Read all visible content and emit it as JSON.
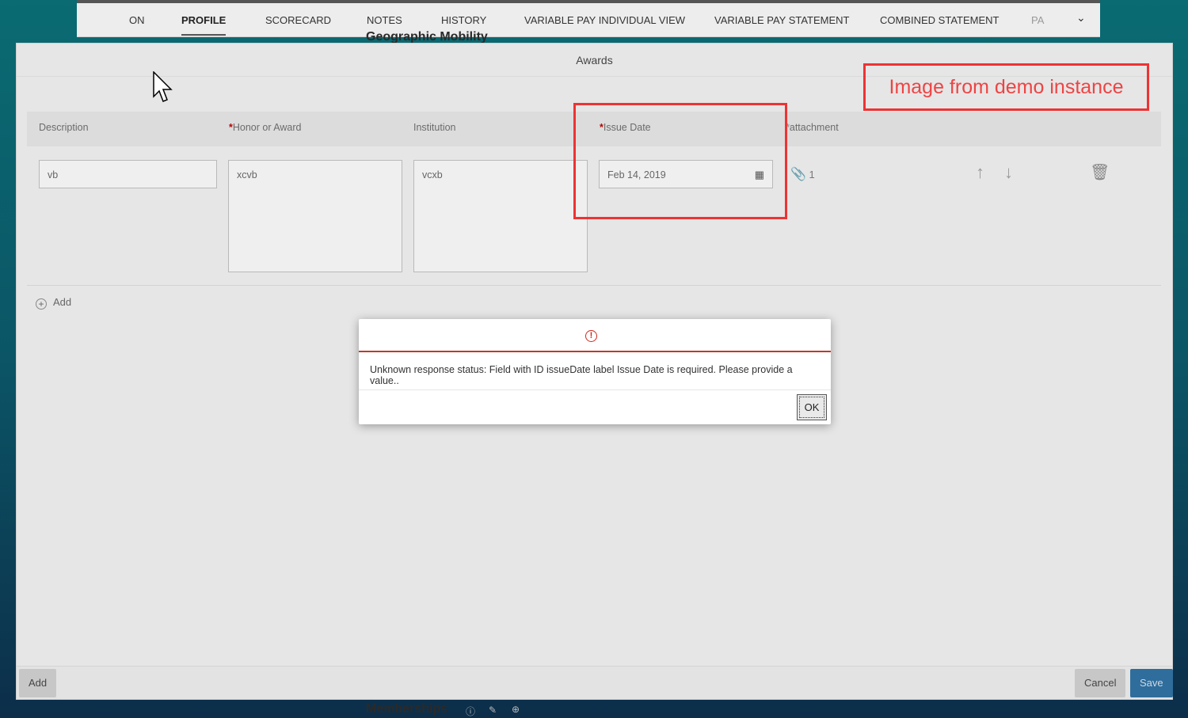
{
  "tabs": [
    {
      "label": "ON"
    },
    {
      "label": "PROFILE"
    },
    {
      "label": "SCORECARD"
    },
    {
      "label": "NOTES"
    },
    {
      "label": "HISTORY"
    },
    {
      "label": "VARIABLE PAY INDIVIDUAL VIEW"
    },
    {
      "label": "VARIABLE PAY STATEMENT"
    },
    {
      "label": "COMBINED STATEMENT"
    },
    {
      "label": "PA"
    }
  ],
  "behind": {
    "geo_heading": "Geographic Mobility",
    "memberships_heading": "Memberships"
  },
  "awards": {
    "title": "Awards",
    "columns": {
      "description": "Description",
      "honor": "Honor or Award",
      "institution": "Institution",
      "issue_date": "Issue Date",
      "attachment": "attachment"
    },
    "row": {
      "description": "vb",
      "honor": "xcvb",
      "institution": "vcxb",
      "issue_date": "Feb 14, 2019",
      "attachment_count": "1"
    },
    "add_row_label": "Add",
    "footer": {
      "add": "Add",
      "cancel": "Cancel",
      "save": "Save"
    }
  },
  "annotation": {
    "label": "Image from demo instance",
    "color": "#e33333"
  },
  "error_dialog": {
    "message": "Unknown response status: Field with ID issueDate label Issue Date is required. Please provide a value..",
    "ok": "OK"
  }
}
